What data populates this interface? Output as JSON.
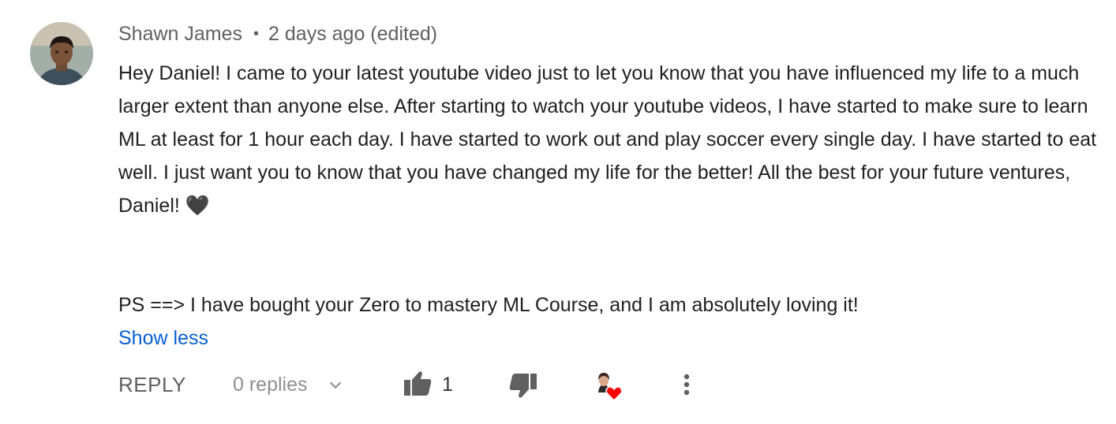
{
  "comment": {
    "author": "Shawn James",
    "separator": "•",
    "timestamp": "2 days ago (edited)",
    "paragraph_1": "Hey Daniel! I came to your latest youtube video just to let you know that you have influenced my life to a much larger extent than anyone else. After starting to watch your youtube videos, I have started to make sure to learn ML at least for 1 hour each day. I have started to work out and play soccer every single day. I have started to eat well. I just want you to know that you have changed my life for the better! All the best for your future ventures, Daniel! 🖤",
    "paragraph_2": "PS ==> I have bought your Zero to mastery ML Course, and I am absolutely loving it!",
    "show_less_label": "Show less"
  },
  "actions": {
    "reply_label": "REPLY",
    "replies_label": "0 replies",
    "like_count": "1",
    "like_icon": "thumbs-up-icon",
    "dislike_icon": "thumbs-down-icon",
    "creator_heart_icon": "creator-heart-icon",
    "more_icon": "more-vert-icon"
  },
  "colors": {
    "link": "#065fd4",
    "meta": "#606060",
    "icon": "#606060",
    "heart": "#ff0000"
  }
}
